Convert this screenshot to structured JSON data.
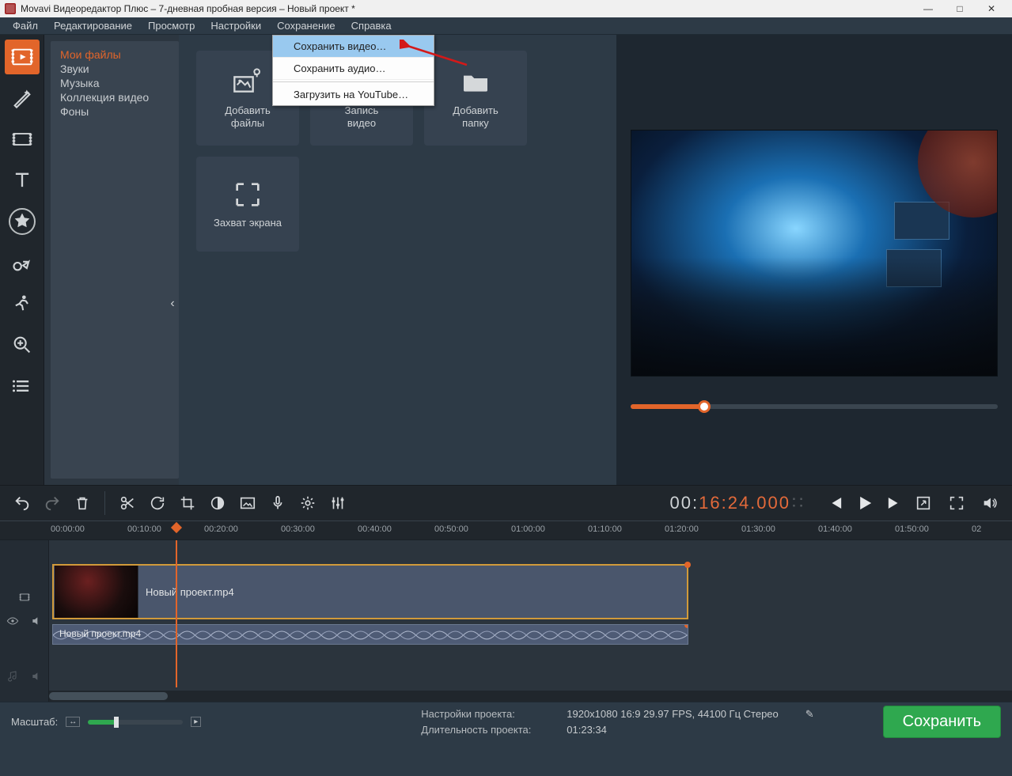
{
  "window": {
    "title": "Movavi Видеоредактор Плюс – 7-дневная пробная версия – Новый проект *"
  },
  "menubar": {
    "file": "Файл",
    "edit": "Редактирование",
    "view": "Просмотр",
    "settings": "Настройки",
    "save": "Сохранение",
    "help": "Справка"
  },
  "save_menu": {
    "save_video": "Сохранить видео…",
    "save_audio": "Сохранить аудио…",
    "upload_youtube": "Загрузить на YouTube…"
  },
  "library": {
    "my_files": "Мои файлы",
    "sounds": "Звуки",
    "music": "Музыка",
    "video_collection": "Коллекция видео",
    "backgrounds": "Фоны"
  },
  "tiles": {
    "add_files": "Добавить\nфайлы",
    "record_video": "Запись\nвидео",
    "add_folder": "Добавить\nпапку",
    "screen_capture": "Захват экрана"
  },
  "player": {
    "timecode_prefix": "00:",
    "timecode_accent": "16:24.000"
  },
  "ruler": {
    "ticks": [
      "00:00:00",
      "00:10:00",
      "00:20:00",
      "00:30:00",
      "00:40:00",
      "00:50:00",
      "01:00:00",
      "01:10:00",
      "01:20:00",
      "01:30:00",
      "01:40:00",
      "01:50:00"
    ],
    "tail": "02"
  },
  "timeline": {
    "video_clip_name": "Новый проект.mp4",
    "audio_clip_name": "Новый проект.mp4"
  },
  "bottom": {
    "zoom_label": "Масштаб:",
    "project_settings_label": "Настройки проекта:",
    "project_settings_value": "1920x1080 16:9 29.97 FPS, 44100 Гц Стерео",
    "project_duration_label": "Длительность проекта:",
    "project_duration_value": "01:23:34",
    "save_button": "Сохранить"
  }
}
